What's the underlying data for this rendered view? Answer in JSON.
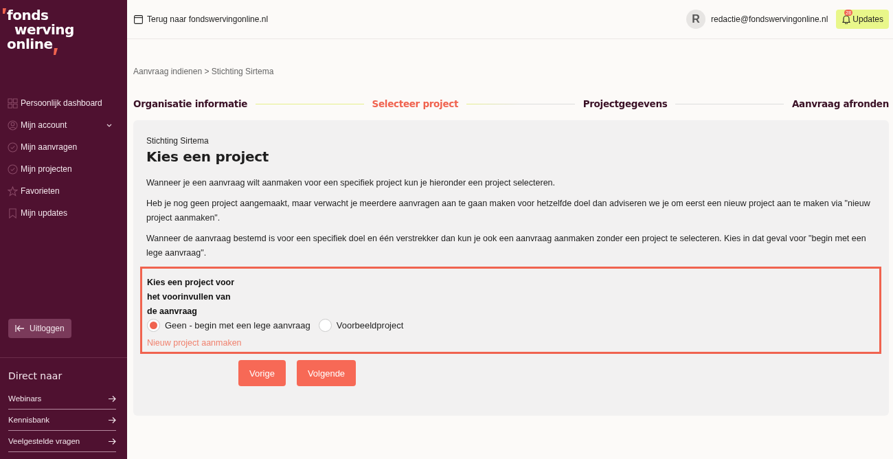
{
  "logo": {
    "lines": [
      "fonds",
      "werving",
      "online"
    ]
  },
  "nav": [
    {
      "label": "Persoonlijk dashboard",
      "kind": "grid",
      "expandable": false
    },
    {
      "label": "Mijn account",
      "kind": "user",
      "expandable": true
    },
    {
      "label": "Mijn aanvragen",
      "kind": "check",
      "expandable": false
    },
    {
      "label": "Mijn projecten",
      "kind": "check",
      "expandable": false
    },
    {
      "label": "Favorieten",
      "kind": "star",
      "expandable": false
    },
    {
      "label": "Mijn updates",
      "kind": "bookmark",
      "expandable": false
    }
  ],
  "logout": {
    "label": "Uitloggen"
  },
  "direct": {
    "title": "Direct naar",
    "links": [
      "Webinars",
      "Kennisbank",
      "Veelgestelde vragen"
    ]
  },
  "topbar": {
    "back_link": "Terug naar fondswervingonline.nl",
    "avatar": "R",
    "email": "redactie@fondswervingonline.nl",
    "updates": {
      "label": "Updates",
      "count": "28"
    }
  },
  "breadcrumb": "Aanvraag indienen > Stichting Sirtema",
  "steps": [
    {
      "label": "Organisatie informatie",
      "selected": false
    },
    {
      "label": "Selecteer project",
      "selected": true
    },
    {
      "label": "Projectgegevens",
      "selected": false
    },
    {
      "label": "Aanvraag afronden",
      "selected": false
    }
  ],
  "card": {
    "subtitle": "Stichting Sirtema",
    "title": "Kies een project",
    "paragraphs": [
      "Wanneer je een aanvraag wilt aanmaken voor een specifiek project kun je hieronder een project selecteren.",
      "Heb je nog geen project aangemaakt, maar verwacht je meerdere aanvragen aan te gaan maken voor hetzelfde doel dan adviseren we je om eerst een nieuw project aan te maken via \"nieuw project aanmaken\".",
      "Wanneer de aanvraag bestemd is voor een specifiek doel en één verstrekker dan kun je ook een aanvraag aanmaken zonder een project te selecteren. Kies in dat geval voor \"begin met een lege aanvraag\"."
    ],
    "question_lines": [
      "Kies een project voor",
      "het voorinvullen van",
      "de aanvraag"
    ],
    "options": [
      {
        "label": "Geen - begin met een lege aanvraag",
        "selected": true
      },
      {
        "label": "Voorbeeldproject",
        "selected": false
      }
    ],
    "new_project_link": "Nieuw project aanmaken",
    "buttons": [
      "Vorige",
      "Volgende"
    ]
  }
}
